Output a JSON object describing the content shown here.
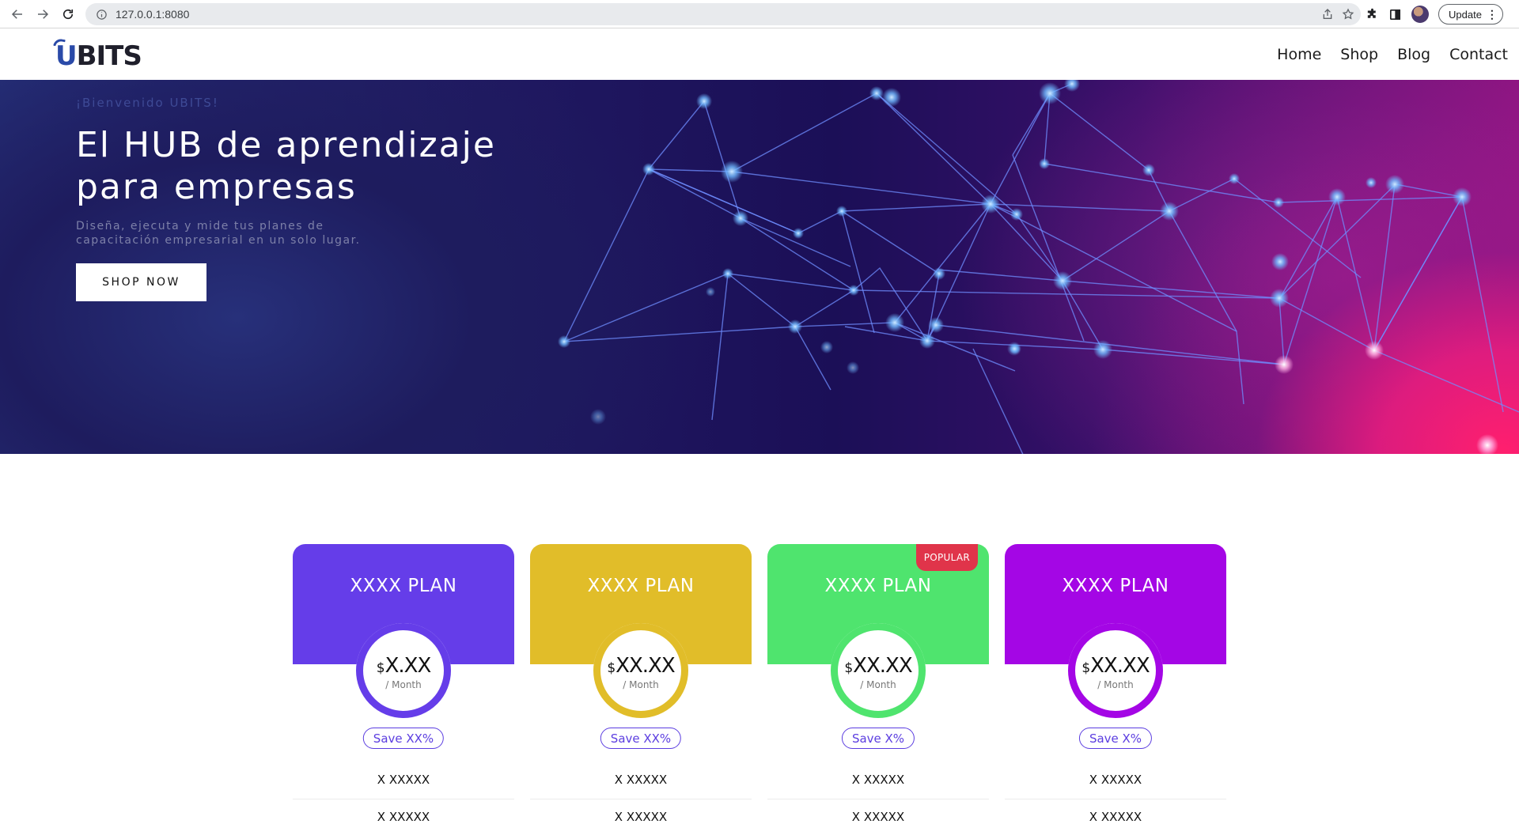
{
  "browser": {
    "url": "127.0.0.1:8080",
    "update_label": "Update"
  },
  "site": {
    "brand": {
      "prefix": "U",
      "rest": "BITS"
    },
    "nav": [
      {
        "label": "Home"
      },
      {
        "label": "Shop"
      },
      {
        "label": "Blog"
      },
      {
        "label": "Contact"
      }
    ]
  },
  "hero": {
    "eyebrow": "¡Bienvenido UBITS!",
    "title": "El HUB de aprendizaje para empresas",
    "subtitle": "Diseña, ejecuta y mide tus planes de capacitación empresarial en un solo lugar.",
    "cta_label": "SHOP NOW"
  },
  "plans": [
    {
      "name": "XXXX PLAN",
      "currency": "$",
      "amount": "X.XX",
      "period": "/ Month",
      "save": "Save XX%",
      "features": [
        "X XXXXX",
        "X XXXXX"
      ],
      "color": "#653de9",
      "popular": false
    },
    {
      "name": "XXXX PLAN",
      "currency": "$",
      "amount": "XX.XX",
      "period": "/ Month",
      "save": "Save XX%",
      "features": [
        "X XXXXX",
        "X XXXXX"
      ],
      "color": "#e1bd29",
      "popular": false
    },
    {
      "name": "XXXX PLAN",
      "currency": "$",
      "amount": "XX.XX",
      "period": "/ Month",
      "save": "Save X%",
      "features": [
        "X XXXXX",
        "X XXXXX"
      ],
      "color": "#4fe46e",
      "popular": true,
      "popular_label": "POPULAR"
    },
    {
      "name": "XXXX PLAN",
      "currency": "$",
      "amount": "XX.XX",
      "period": "/ Month",
      "save": "Save X%",
      "features": [
        "X XXXXX",
        "X XXXXX"
      ],
      "color": "#a406e5",
      "popular": false
    }
  ],
  "colors": {
    "save_badge": "#5b3de0",
    "popular_tag": "#e0344a"
  }
}
